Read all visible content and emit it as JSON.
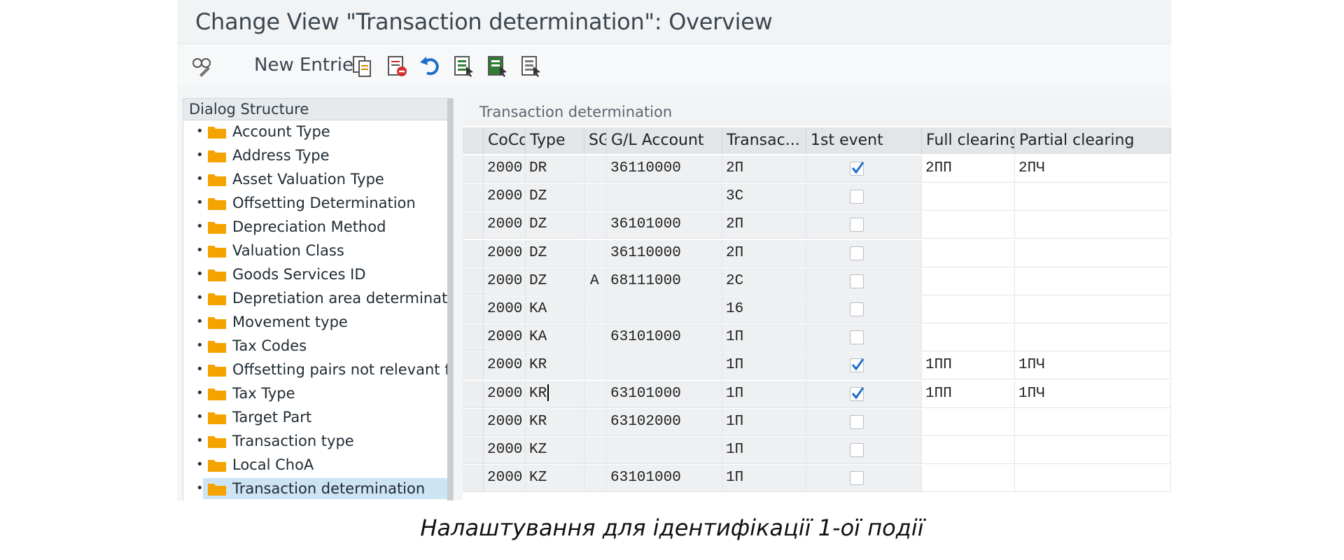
{
  "window": {
    "title": "Change View \"Transaction determination\": Overview"
  },
  "toolbar": {
    "new_entries_label": "New Entries",
    "icons": [
      "display-change-icon",
      "copy-icon",
      "delete-icon",
      "undo-icon",
      "select-all-icon",
      "select-block-icon",
      "deselect-all-icon"
    ]
  },
  "dialog_structure": {
    "header": "Dialog Structure",
    "items": [
      {
        "label": "Account Type"
      },
      {
        "label": "Address Type"
      },
      {
        "label": "Asset Valuation Type"
      },
      {
        "label": "Offsetting Determination"
      },
      {
        "label": "Depreciation Method"
      },
      {
        "label": "Valuation Class"
      },
      {
        "label": "Goods Services ID"
      },
      {
        "label": "Depretiation area determination"
      },
      {
        "label": "Movement type"
      },
      {
        "label": "Tax Codes"
      },
      {
        "label": "Offsetting pairs not relevant fo"
      },
      {
        "label": "Tax Type"
      },
      {
        "label": "Target Part"
      },
      {
        "label": "Transaction type"
      },
      {
        "label": "Local ChoA"
      },
      {
        "label": "Transaction determination",
        "selected": true
      }
    ]
  },
  "table": {
    "caption": "Transaction determination",
    "columns": [
      "CoCd",
      "Type",
      "SG",
      "G/L Account",
      "Transac...",
      "1st event",
      "Full clearing",
      "Partial clearing"
    ],
    "rows": [
      {
        "cocd": "2000",
        "type": "DR",
        "sg": "",
        "gl": "36110000",
        "trans": "2П",
        "first": true,
        "full": "2ПП",
        "partial": "2ПЧ"
      },
      {
        "cocd": "2000",
        "type": "DZ",
        "sg": "",
        "gl": "",
        "trans": "3С",
        "first": false,
        "full": "",
        "partial": ""
      },
      {
        "cocd": "2000",
        "type": "DZ",
        "sg": "",
        "gl": "36101000",
        "trans": "2П",
        "first": false,
        "full": "",
        "partial": ""
      },
      {
        "cocd": "2000",
        "type": "DZ",
        "sg": "",
        "gl": "36110000",
        "trans": "2П",
        "first": false,
        "full": "",
        "partial": ""
      },
      {
        "cocd": "2000",
        "type": "DZ",
        "sg": "A",
        "gl": "68111000",
        "trans": "2С",
        "first": false,
        "full": "",
        "partial": ""
      },
      {
        "cocd": "2000",
        "type": "KA",
        "sg": "",
        "gl": "",
        "trans": "16",
        "first": false,
        "full": "",
        "partial": ""
      },
      {
        "cocd": "2000",
        "type": "KA",
        "sg": "",
        "gl": "63101000",
        "trans": "1П",
        "first": false,
        "full": "",
        "partial": ""
      },
      {
        "cocd": "2000",
        "type": "KR",
        "sg": "",
        "gl": "",
        "trans": "1П",
        "first": true,
        "full": "1ПП",
        "partial": "1ПЧ"
      },
      {
        "cocd": "2000",
        "type": "KR",
        "sg": "",
        "gl": "63101000",
        "trans": "1П",
        "first": true,
        "full": "1ПП",
        "partial": "1ПЧ",
        "focused": true
      },
      {
        "cocd": "2000",
        "type": "KR",
        "sg": "",
        "gl": "63102000",
        "trans": "1П",
        "first": false,
        "full": "",
        "partial": ""
      },
      {
        "cocd": "2000",
        "type": "KZ",
        "sg": "",
        "gl": "",
        "trans": "1П",
        "first": false,
        "full": "",
        "partial": ""
      },
      {
        "cocd": "2000",
        "type": "KZ",
        "sg": "",
        "gl": "63101000",
        "trans": "1П",
        "first": false,
        "full": "",
        "partial": ""
      }
    ]
  },
  "caption": "Налаштування для ідентифікації 1-ої події",
  "colors": {
    "folder": "#f5a300",
    "checkmark": "#1f6fc5",
    "selection": "#cde4f5"
  }
}
